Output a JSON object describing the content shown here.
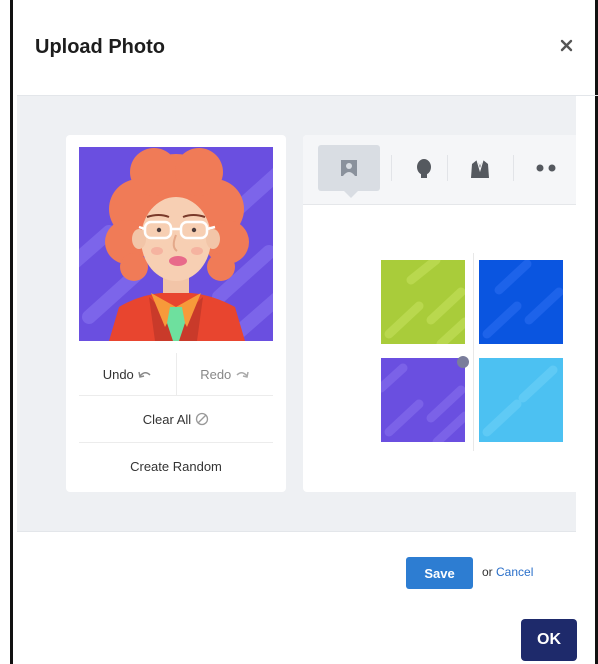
{
  "dialog": {
    "title": "Upload Photo",
    "close_icon": "close-icon"
  },
  "editor": {
    "undo_label": "Undo",
    "redo_label": "Redo",
    "clear_all_label": "Clear All",
    "create_random_label": "Create Random",
    "tabs": [
      {
        "icon": "background-icon",
        "active": true
      },
      {
        "icon": "head-icon",
        "active": false
      },
      {
        "icon": "clothing-icon",
        "active": false
      },
      {
        "icon": "eyes-icon",
        "active": false
      }
    ],
    "swatches": [
      {
        "name": "green",
        "color": "#a9cc3a"
      },
      {
        "name": "blue",
        "color": "#0a55e0"
      },
      {
        "name": "purple",
        "color": "#6a4fe0",
        "selected": true
      },
      {
        "name": "light-blue",
        "color": "#4cc1f2"
      }
    ]
  },
  "footer": {
    "save_label": "Save",
    "or_text": "or",
    "cancel_label": "Cancel",
    "ok_label": "OK"
  },
  "colors": {
    "primary": "#2d7dd2",
    "ok": "#1e2a6b",
    "panel_bg": "#eef0f3"
  }
}
